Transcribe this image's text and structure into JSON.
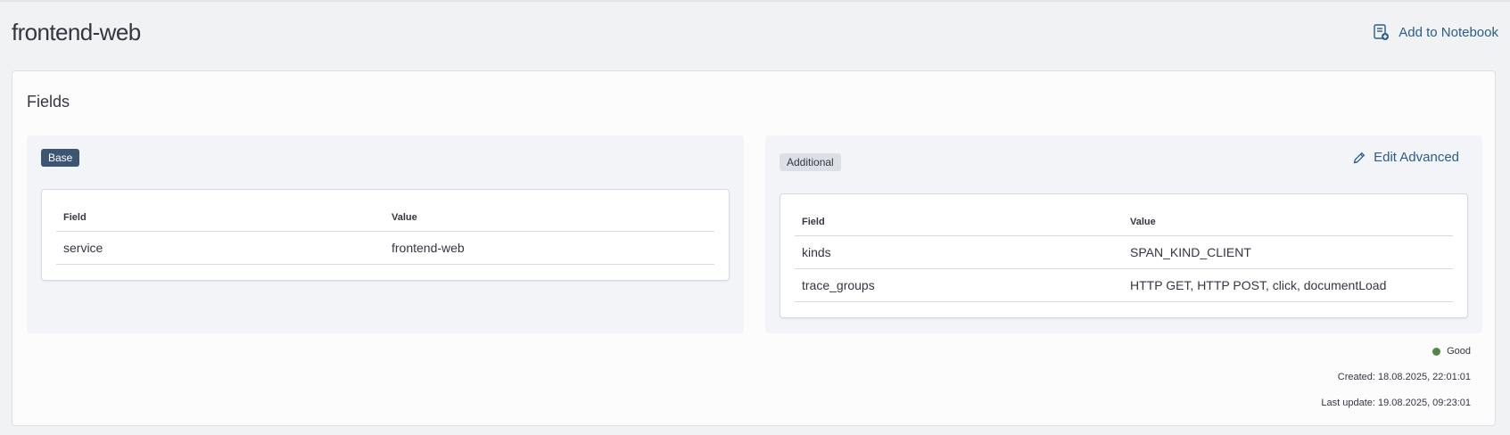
{
  "header": {
    "title": "frontend-web",
    "add_to_notebook_label": "Add to Notebook",
    "add_to_notebook_icon": "notebook-add-icon"
  },
  "fields_panel": {
    "title": "Fields",
    "base": {
      "badge": "Base",
      "columns": [
        "Field",
        "Value"
      ],
      "rows": [
        {
          "field": "service",
          "value": "frontend-web"
        }
      ]
    },
    "additional": {
      "badge": "Additional",
      "edit_label": "Edit Advanced",
      "edit_icon": "pencil-icon",
      "columns": [
        "Field",
        "Value"
      ],
      "rows": [
        {
          "field": "kinds",
          "value": "SPAN_KIND_CLIENT"
        },
        {
          "field": "trace_groups",
          "value": "HTTP GET, HTTP POST, click, documentLoad"
        }
      ]
    }
  },
  "footer": {
    "status_label": "Good",
    "status_color": "#54864a",
    "created": "Created: 18.08.2025, 22:01:01",
    "last_update": "Last update: 19.08.2025, 09:23:01"
  },
  "colors": {
    "accent": "#2b5c8a",
    "base_badge": "#3c5572",
    "additional_badge": "#dcdfe5"
  }
}
